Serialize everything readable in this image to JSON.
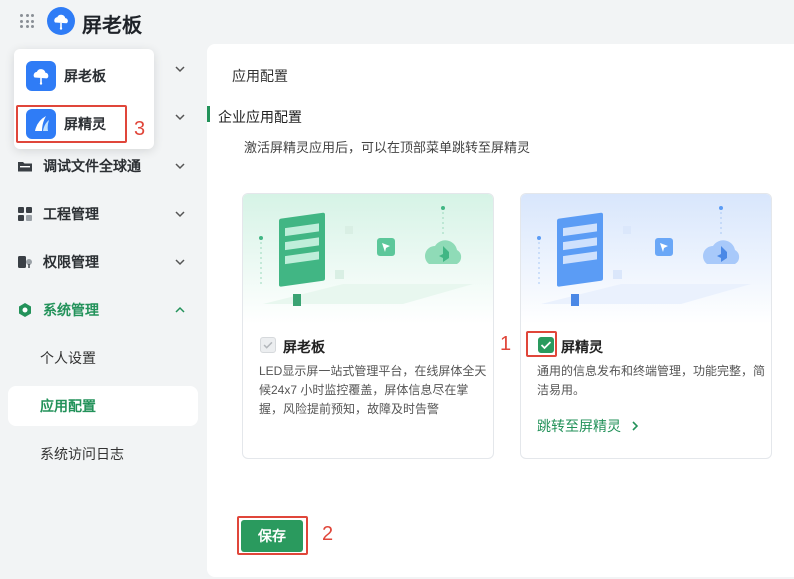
{
  "header": {
    "apps_icon": "grid-dots-icon",
    "logo_icon": "cloud-logo-icon",
    "title": "屏老板"
  },
  "app_switcher": {
    "items": [
      {
        "label": "屏老板",
        "icon": "cloud-logo-icon"
      },
      {
        "label": "屏精灵",
        "icon": "sail-logo-icon"
      }
    ]
  },
  "sidebar": {
    "items": [
      {
        "label": "调试文件全球通",
        "icon": "folder-icon"
      },
      {
        "label": "工程管理",
        "icon": "grid-blocks-icon"
      },
      {
        "label": "权限管理",
        "icon": "key-icon"
      },
      {
        "label": "系统管理",
        "icon": "gear-icon",
        "expanded": true
      }
    ],
    "subitems": [
      {
        "label": "个人设置",
        "active": false
      },
      {
        "label": "应用配置",
        "active": true
      },
      {
        "label": "系统访问日志",
        "active": false
      }
    ]
  },
  "main": {
    "breadcrumb": "应用配置",
    "section_title": "企业应用配置",
    "description": "激活屏精灵应用后，可以在顶部菜单跳转至屏精灵",
    "cards": [
      {
        "name": "屏老板",
        "checked": true,
        "disabled": true,
        "text": "LED显示屏一站式管理平台，在线屏体全天候24x7 小时监控覆盖，屏体信息尽在掌握，风险提前预知，故障及时告警",
        "accent": "#5cc79a"
      },
      {
        "name": "屏精灵",
        "checked": true,
        "disabled": false,
        "text": "通用的信息发布和终端管理，功能完整，简洁易用。",
        "link": "跳转至屏精灵",
        "accent": "#5b9cf5"
      }
    ],
    "save_label": "保存"
  },
  "annotations": [
    "1",
    "2",
    "3"
  ],
  "colors": {
    "brand_green": "#23925a",
    "button_green": "#2a9a5e",
    "annotation_red": "#e0463a",
    "logo_blue": "#2f7cf6"
  }
}
